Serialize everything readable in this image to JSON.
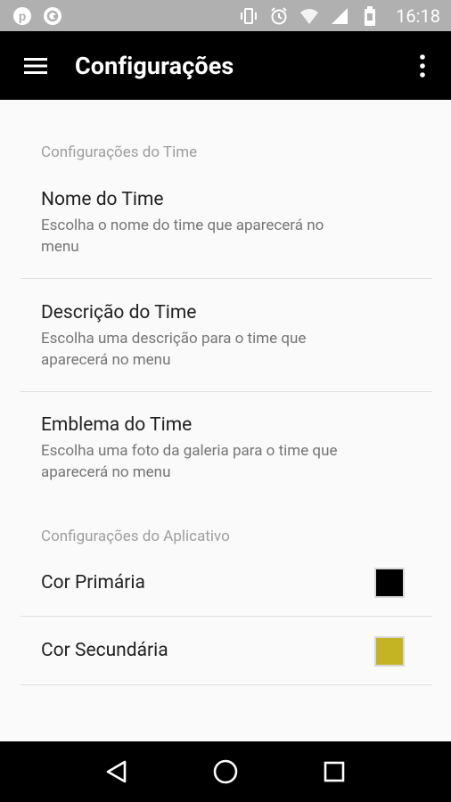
{
  "status_bar": {
    "time": "16:18",
    "icons": [
      "pinterest-icon",
      "app-circle-icon",
      "vibrate-icon",
      "alarm-icon",
      "wifi-icon",
      "signal-icon",
      "battery-icon"
    ]
  },
  "app_bar": {
    "title": "Configurações",
    "left_icon": "hamburger-menu-icon",
    "right_icon": "overflow-menu-icon"
  },
  "sections": [
    {
      "header": "Configurações do Time",
      "items": [
        {
          "title": "Nome do Time",
          "summary_lines": [
            "Escolha o nome do time que aparecerá no",
            "menu"
          ]
        },
        {
          "title": "Descrição do Time",
          "summary_lines": [
            "Escolha uma descrição para o time que",
            "aparecerá no menu"
          ]
        },
        {
          "title": "Emblema do Time",
          "summary_lines": [
            "Escolha uma foto da galeria para o time que",
            "aparecerá no menu"
          ]
        }
      ]
    },
    {
      "header": "Configurações do Aplicativo",
      "items": [
        {
          "title": "Cor Primária",
          "color": "#000000"
        },
        {
          "title": "Cor Secundária",
          "color": "#c4b424"
        }
      ]
    }
  ],
  "nav_bar": {
    "icons": [
      "back-icon",
      "home-icon",
      "recents-icon"
    ]
  },
  "colors": {
    "status_bar": "#b0b0b0",
    "app_bar": "#000000",
    "background": "#fafafa",
    "section_header": "#9e9e9e"
  }
}
